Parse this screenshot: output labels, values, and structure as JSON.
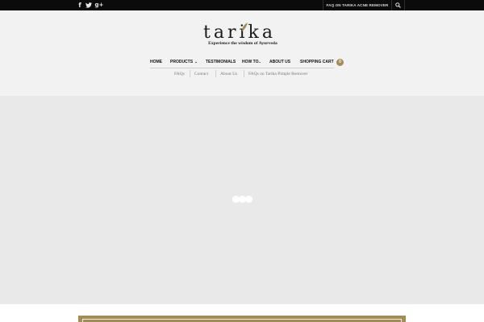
{
  "topbar": {
    "social": [
      {
        "name": "facebook-icon",
        "glyph": "f"
      },
      {
        "name": "twitter-icon",
        "glyph": "t"
      },
      {
        "name": "google-plus-icon",
        "glyph": "g+"
      }
    ],
    "faq_link": "FAQ ON TARIKA ACNE REMOVER",
    "search_icon": "search-icon"
  },
  "logo": {
    "word": "tarika",
    "tagline": "Experience the wisdom of Ayurveda",
    "accent_color": "#a48c58"
  },
  "nav": {
    "items": [
      {
        "label": "HOME"
      },
      {
        "label": "PRODUCTS",
        "has_dropdown": true
      },
      {
        "label": "TESTIMONIALS"
      },
      {
        "label": "HOW TO.."
      },
      {
        "label": "ABOUT US"
      },
      {
        "label": "SHOPPING CART"
      }
    ],
    "cart_count": "0"
  },
  "subnav": {
    "items": [
      {
        "label": "FAQs"
      },
      {
        "label": "Contact"
      },
      {
        "label": "About Us"
      },
      {
        "label": "FAQs on Tarika Pimple Remover"
      }
    ]
  },
  "colors": {
    "topbar": "#0b0b0b",
    "header_bg": "#f2f2f2",
    "slider_bg": "#e9e9e9",
    "accent": "#a48c58"
  }
}
